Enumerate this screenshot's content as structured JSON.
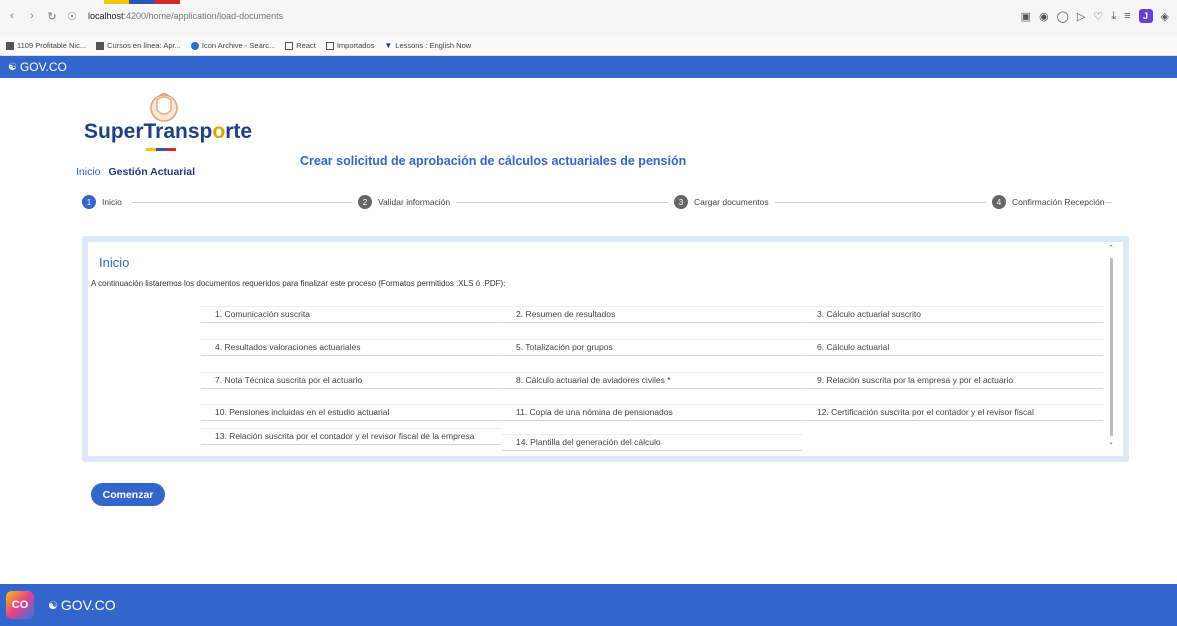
{
  "browser": {
    "url_host": "localhost",
    "url_rest": ":4200/home/application/load-documents",
    "bookmarks": [
      {
        "label": "1109 Profitable Nic...",
        "icon": "file-icon"
      },
      {
        "label": "Cursos en línea: Apr...",
        "icon": "file-icon"
      },
      {
        "label": "Icon Archive - Searc...",
        "icon": "iconarchive-icon"
      },
      {
        "label": "React",
        "icon": "folder-icon"
      },
      {
        "label": "Importados",
        "icon": "folder-icon"
      },
      {
        "label": "Lessons : English Now",
        "icon": "heart-icon"
      }
    ],
    "avatar_letter": "J"
  },
  "gov_bar": {
    "label": "GOV.CO"
  },
  "brand": {
    "name_prefix": "SuperTransp",
    "name_o": "o",
    "name_suffix": "rte"
  },
  "breadcrumb": {
    "home": "Inicio",
    "current": "Gestión Actuarial"
  },
  "page_title": "Crear solicitud de aprobación de cálculos actuariales de pensión",
  "steps": [
    {
      "num": "1",
      "label": "Inicio"
    },
    {
      "num": "2",
      "label": "Validar información"
    },
    {
      "num": "3",
      "label": "Cargar documentos"
    },
    {
      "num": "4",
      "label": "Confirmación Recepción"
    }
  ],
  "card": {
    "title": "Inicio",
    "description": "A continuación listaremos los documentos requeridos para finalizar este proceso (Formatos permitidos .XLS ó .PDF):"
  },
  "documents": [
    "1. Comunicación suscrita",
    "2. Resumen de resultados",
    "3. Cálculo actuarial suscrito",
    "4. Resultados valoraciones actuariales",
    "5. Totalización por grupos",
    "6. Cálculo actuarial",
    "7. Nota Técnica suscrita por el actuario",
    "8. Cálculo actuarial de aviadores civiles *",
    "9. Relación suscrita por la empresa y por el actuario",
    "10. Pensiones incluidas en el estudio actuarial",
    "11. Copia de una nómina de pensionados",
    "12. Certificación suscrita por el contador y el revisor fiscal",
    "13. Relación suscrita por el contador y el revisor fiscal de la empresa",
    "14. Plantilla del generación del cálculo"
  ],
  "start_button": "Comenzar",
  "footer": {
    "badge": "CO",
    "label": "GOV.CO"
  },
  "colors": {
    "primary": "#3366cc",
    "brand_dark": "#1d3f86",
    "brand_accent": "#e0a300"
  }
}
